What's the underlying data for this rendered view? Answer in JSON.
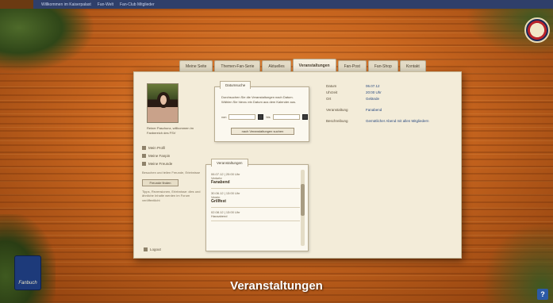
{
  "topbar": {
    "links": [
      "Willkommen im Kaiserpalast",
      "Fan-Welt",
      "Fan-Club Mitglieder"
    ]
  },
  "tabs": [
    {
      "label": "Meine Seite",
      "active": false
    },
    {
      "label": "Themen-Fan-Serie",
      "active": false
    },
    {
      "label": "Aktuelles",
      "active": false
    },
    {
      "label": "Veranstaltungen",
      "active": true
    },
    {
      "label": "Fan-Post",
      "active": false
    },
    {
      "label": "Fan-Shop",
      "active": false
    },
    {
      "label": "Kontakt",
      "active": false
    }
  ],
  "profile": {
    "caption": "Reiner Paschunz, willkommen im Fanbereich des FSV",
    "menu": [
      "Mein Profil",
      "Meine Fanpin",
      "Meine Freunde"
    ],
    "hint1": "Besuchen und teilen Freunde, Erlebnisse",
    "button": "Freunde finden",
    "hint2": "Tipps, Rezensionen, Erlebnisse: dies und ähnliche Inhalte werden im Forum veröffentlicht",
    "logout": "Logout"
  },
  "search": {
    "tab": "Datumsuche",
    "text": "Durchsuchen Sie die Veranstaltungen nach Datum. Wählen Sie hierzu ein Datum aus dem Kalender aus.",
    "from_label": "von",
    "to_label": "bis",
    "button": "nach Veranstaltungen suchen"
  },
  "events": {
    "tab": "Veranstaltungen",
    "items": [
      {
        "date": "06.07.12 | 20:00 Uhr",
        "type": "Verkehr",
        "title": "Fanabend"
      },
      {
        "date": "30.06.12 | 13:00 Uhr",
        "type": "Verein",
        "title": "Grillfest"
      },
      {
        "date": "02.08.12 | 13:00 Uhr",
        "type": "Hausabend",
        "title": ""
      }
    ]
  },
  "details": {
    "rows": [
      {
        "key": "Datum",
        "value": "06.07.12"
      },
      {
        "key": "Uhrzeit",
        "value": "20:00 Uhr"
      },
      {
        "key": "Ort",
        "value": "Gelände"
      }
    ],
    "type_row": {
      "key": "Veranstaltung",
      "value": "Fanabend"
    },
    "desc_row": {
      "key": "Beschreibung",
      "value": "Gemütlicher Abend mit allen Mitgliedern"
    }
  },
  "book_label": "Fanbuch",
  "help_button": "?",
  "caption": "Veranstaltungen",
  "colors": {
    "wood": "#c9661f",
    "panel": "#f3ecd9",
    "topbar": "#2f3f6a",
    "link": "#2a4a80"
  }
}
